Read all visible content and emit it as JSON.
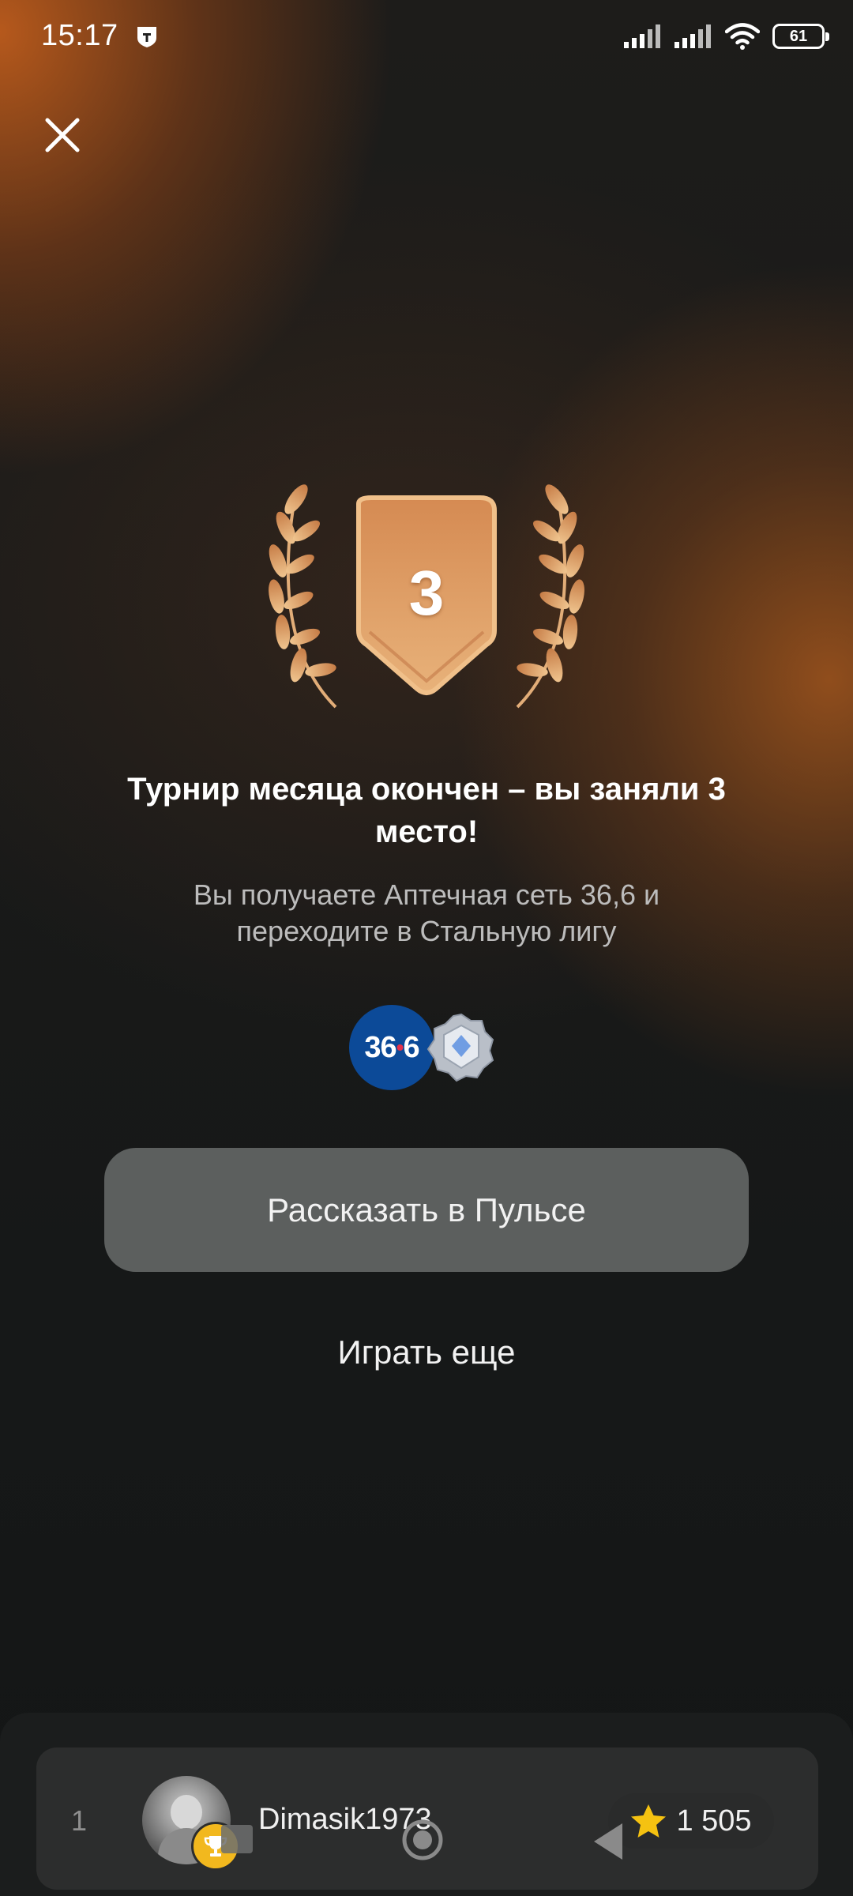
{
  "status_bar": {
    "time": "15:17",
    "battery": "61"
  },
  "award": {
    "place_number": "3"
  },
  "result": {
    "title": "Турнир месяца окончен – вы заняли 3 место!",
    "subtitle": "Вы получаете Аптечная сеть 36,6 и переходите в Стальную лигу"
  },
  "prize": {
    "logo_text_a": "36",
    "logo_dot": "•",
    "logo_text_b": "6"
  },
  "actions": {
    "share_label": "Рассказать в Пульсе",
    "play_again_label": "Играть еще"
  },
  "leaderboard": {
    "rank": "1",
    "player_name": "Dimasik1973",
    "score": "1 505"
  },
  "colors": {
    "accent_orange": "#c46a2a",
    "badge_gold": "#e3a86a",
    "button_bg": "#5c5f5e",
    "prize_blue": "#0c4a98"
  }
}
